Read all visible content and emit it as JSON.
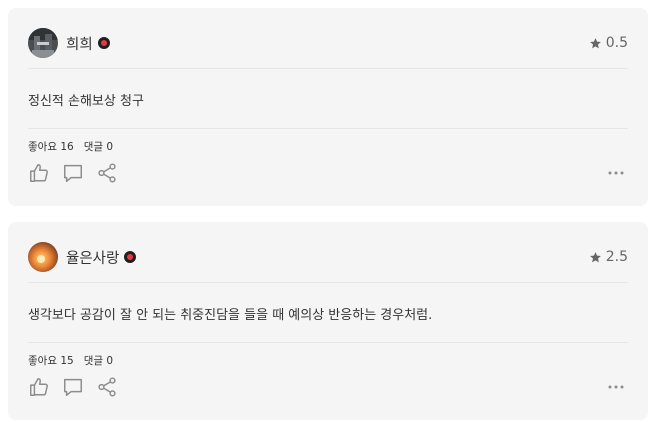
{
  "reviews": [
    {
      "user": "희희",
      "rating": "0.5",
      "comment": "정신적 손해보상 청구",
      "likes_label": "좋아요",
      "likes_count": "16",
      "comments_label": "댓글",
      "comments_count": "0",
      "avatar_style": "dark-grey-photo"
    },
    {
      "user": "율은사랑",
      "rating": "2.5",
      "comment": "생각보다 공감이 잘 안 되는 취중진담을 들을 때 예의상 반응하는 경우처럼.",
      "likes_label": "좋아요",
      "likes_count": "15",
      "comments_label": "댓글",
      "comments_count": "0",
      "avatar_style": "warm-orange-photo"
    }
  ],
  "colors": {
    "card_bg": "#f5f5f5",
    "icon": "#8c8c8c",
    "badge_outer": "#1f1f1f",
    "badge_inner": "#e8373f"
  },
  "icons": [
    "star-icon",
    "thumbs-up-icon",
    "comment-icon",
    "share-icon",
    "more-icon"
  ]
}
